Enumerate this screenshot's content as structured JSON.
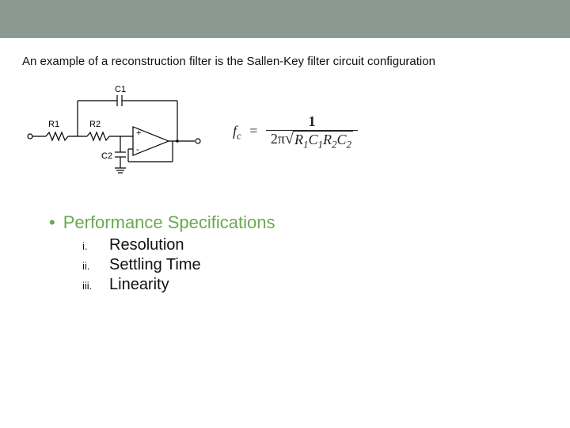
{
  "intro_text": "An example of a reconstruction filter is the Sallen-Key filter circuit configuration",
  "circuit": {
    "labels": {
      "C1": "C1",
      "C2": "C2",
      "R1": "R1",
      "R2": "R2",
      "plus": "+",
      "minus": "-"
    }
  },
  "formula": {
    "lhs_var": "f",
    "lhs_sub": "c",
    "equals": "=",
    "numerator": "1",
    "two_pi": "2π",
    "r1": "R",
    "r1sub": "1",
    "c1": "C",
    "c1sub": "1",
    "r2": "R",
    "r2sub": "2",
    "c2": "C",
    "c2sub": "2"
  },
  "spec_bullet": "•",
  "spec_title": "Performance Specifications",
  "spec_items": [
    {
      "roman": "i.",
      "label": "Resolution"
    },
    {
      "roman": "ii.",
      "label": "Settling Time"
    },
    {
      "roman": "iii.",
      "label": "Linearity"
    }
  ]
}
